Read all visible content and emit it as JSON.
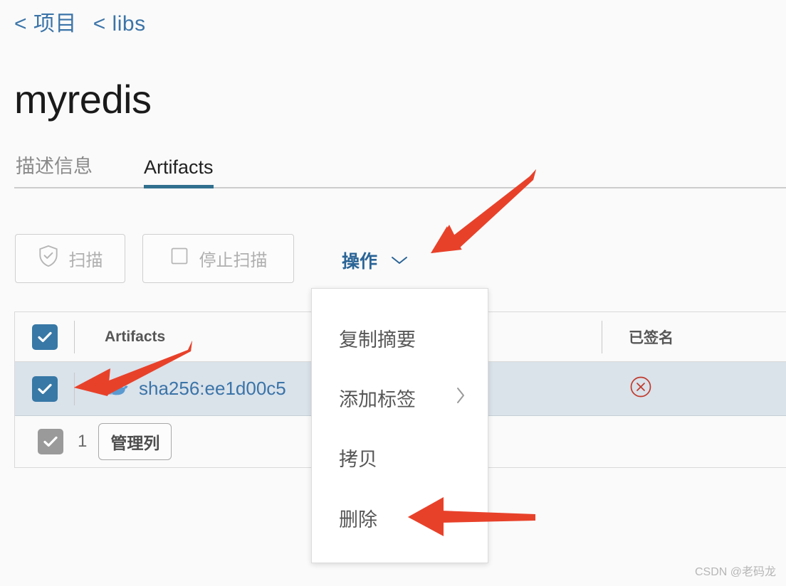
{
  "breadcrumb": {
    "items": [
      {
        "label": "< 项目"
      },
      {
        "label": "< libs"
      }
    ]
  },
  "page": {
    "title": "myredis"
  },
  "tabs": [
    {
      "label": "描述信息",
      "active": false
    },
    {
      "label": "Artifacts",
      "active": true
    }
  ],
  "toolbar": {
    "scan_label": "扫描",
    "scan_icon": "shield-check-icon",
    "stop_scan_label": "停止扫描",
    "stop_scan_icon": "stop-square-icon",
    "actions_label": "操作",
    "actions_chevron": "chevron-down-icon"
  },
  "menu": {
    "items": [
      {
        "label": "复制摘要",
        "submenu": false,
        "chevron": ""
      },
      {
        "label": "添加标签",
        "submenu": true,
        "chevron": "›"
      },
      {
        "label": "拷贝",
        "submenu": false,
        "chevron": ""
      },
      {
        "label": "删除",
        "submenu": false,
        "chevron": ""
      }
    ]
  },
  "table": {
    "headers": {
      "artifacts": "Artifacts",
      "signed": "已签名"
    },
    "rows": [
      {
        "checked": true,
        "icon": "docker-whale-icon",
        "digest": "sha256:ee1d00c5",
        "signed_icon": "circle-x-icon"
      }
    ],
    "footer": {
      "checked": true,
      "count": "1",
      "columns_button": "管理列"
    }
  },
  "colors": {
    "link_blue": "#3B74A8",
    "tab_active_underline": "#31708F",
    "checkbox_blue": "#3778A6",
    "row_selected_bg": "#DAE2EA",
    "arrow_red": "#E8412A",
    "signed_red": "#C0392B",
    "disabled_grey": "#AFAFAF"
  },
  "watermark": {
    "text": "CSDN @老码龙"
  }
}
